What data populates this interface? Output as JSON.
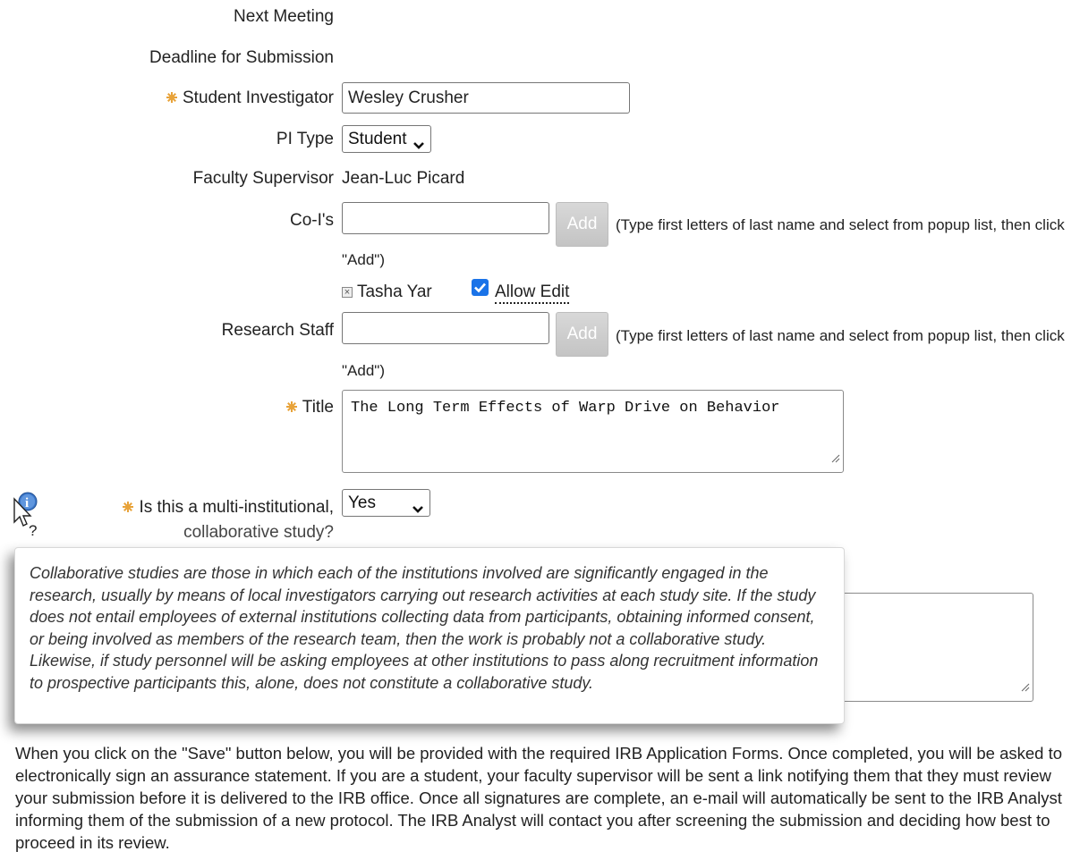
{
  "labels": {
    "next_meeting": "Next Meeting",
    "deadline": "Deadline for Submission",
    "student_investigator": "Student Investigator",
    "pi_type": "PI Type",
    "faculty_supervisor": "Faculty Supervisor",
    "co_is": "Co-I's",
    "research_staff": "Research Staff",
    "title": "Title",
    "multi_line1": "Is this a multi-institutional,",
    "multi_line2": "collaborative study?"
  },
  "fields": {
    "student_investigator_value": "Wesley Crusher",
    "pi_type_selected": "Student",
    "faculty_supervisor_value": "Jean-Luc Picard",
    "co_is_value": "",
    "research_staff_value": "",
    "title_value": "The Long Term Effects of Warp Drive on Behavior",
    "multi_selected": "Yes",
    "second_textarea_value": ""
  },
  "buttons": {
    "add_coi": "Add",
    "add_staff": "Add"
  },
  "hints": {
    "coi_hint_line1": "(Type first letters of last name and select from popup list, then click",
    "coi_hint_line2": "\"Add\")",
    "staff_hint_line1": "(Type first letters of last name and select from popup list, then click",
    "staff_hint_line2": "\"Add\")"
  },
  "co_investigators": [
    {
      "name": "Tasha Yar",
      "allow_edit_label": "Allow Edit",
      "allow_edit_checked": true
    }
  ],
  "tooltip": {
    "text": "Collaborative studies are those in which each of the institutions involved are significantly engaged in the research, usually by means of local investigators carrying out research activities at each study site. If the study does not entail employees of external institutions collecting data from participants, obtaining informed consent, or being involved as members of the research team, then the work is probably not a collaborative study. Likewise, if study personnel will be asking employees at other institutions to pass along recruitment information to prospective participants this, alone, does not constitute a collaborative study."
  },
  "instructions": {
    "text": "When you click on the \"Save\" button below, you will be provided with the required IRB Application Forms. Once completed, you will be asked to electronically sign an assurance statement. If you are a student, your faculty supervisor will be sent a link notifying them that they must review your submission before it is delivered to the IRB office. Once all signatures are complete, an e-mail will automatically be sent to the IRB Analyst informing them of the submission of a new protocol. The IRB Analyst will contact you after screening the submission and deciding how best to proceed in its review."
  },
  "icons": {
    "required": "required-asterisk-icon",
    "help_cursor": "help-cursor-icon",
    "info": "info-icon",
    "dropdown": "chevron-down-icon"
  },
  "colors": {
    "required": "#e8a33a",
    "checkbox": "#1a73e8",
    "add_button": "#c8c8c8"
  }
}
